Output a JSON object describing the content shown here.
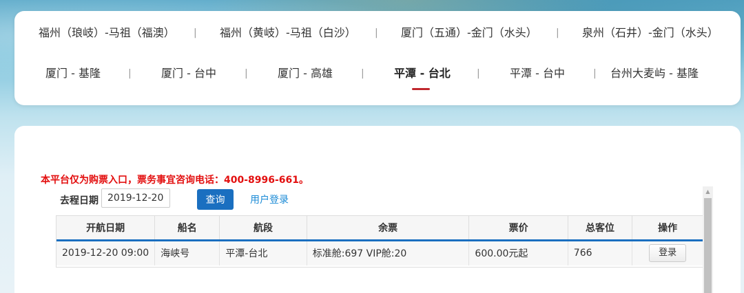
{
  "routes": {
    "row1": [
      "福州（琅岐）-马祖（福澳）",
      "福州（黄岐）-马祖（白沙）",
      "厦门（五通）-金门（水头）",
      "泉州（石井）-金门（水头）"
    ],
    "row2": [
      "厦门 - 基隆",
      "厦门 - 台中",
      "厦门 - 高雄",
      "平潭 - 台北",
      "平潭 - 台中",
      "台州大麦屿 - 基隆"
    ],
    "separator": "|",
    "active": "平潭 - 台北"
  },
  "notice": "本平台仅为购票入口，票务事宜咨询电话：400-8996-661。",
  "query": {
    "label": "去程日期",
    "date_value": "2019-12-20",
    "button_label": "查询",
    "login_link": "用户登录"
  },
  "table": {
    "headers": [
      "开航日期",
      "船名",
      "航段",
      "余票",
      "票价",
      "总客位",
      "操作"
    ],
    "rows": [
      {
        "date": "2019-12-20 09:00",
        "ship": "海峡号",
        "route": "平潭-台北",
        "remaining": "标准舱:697 VIP舱:20",
        "price": "600.00元起",
        "capacity": "766",
        "action": "登录"
      }
    ]
  },
  "colors": {
    "accent": "#1a6fc0",
    "notice": "#e30f0f",
    "active_underline": "#c0272d",
    "link": "#1a8ad6"
  }
}
